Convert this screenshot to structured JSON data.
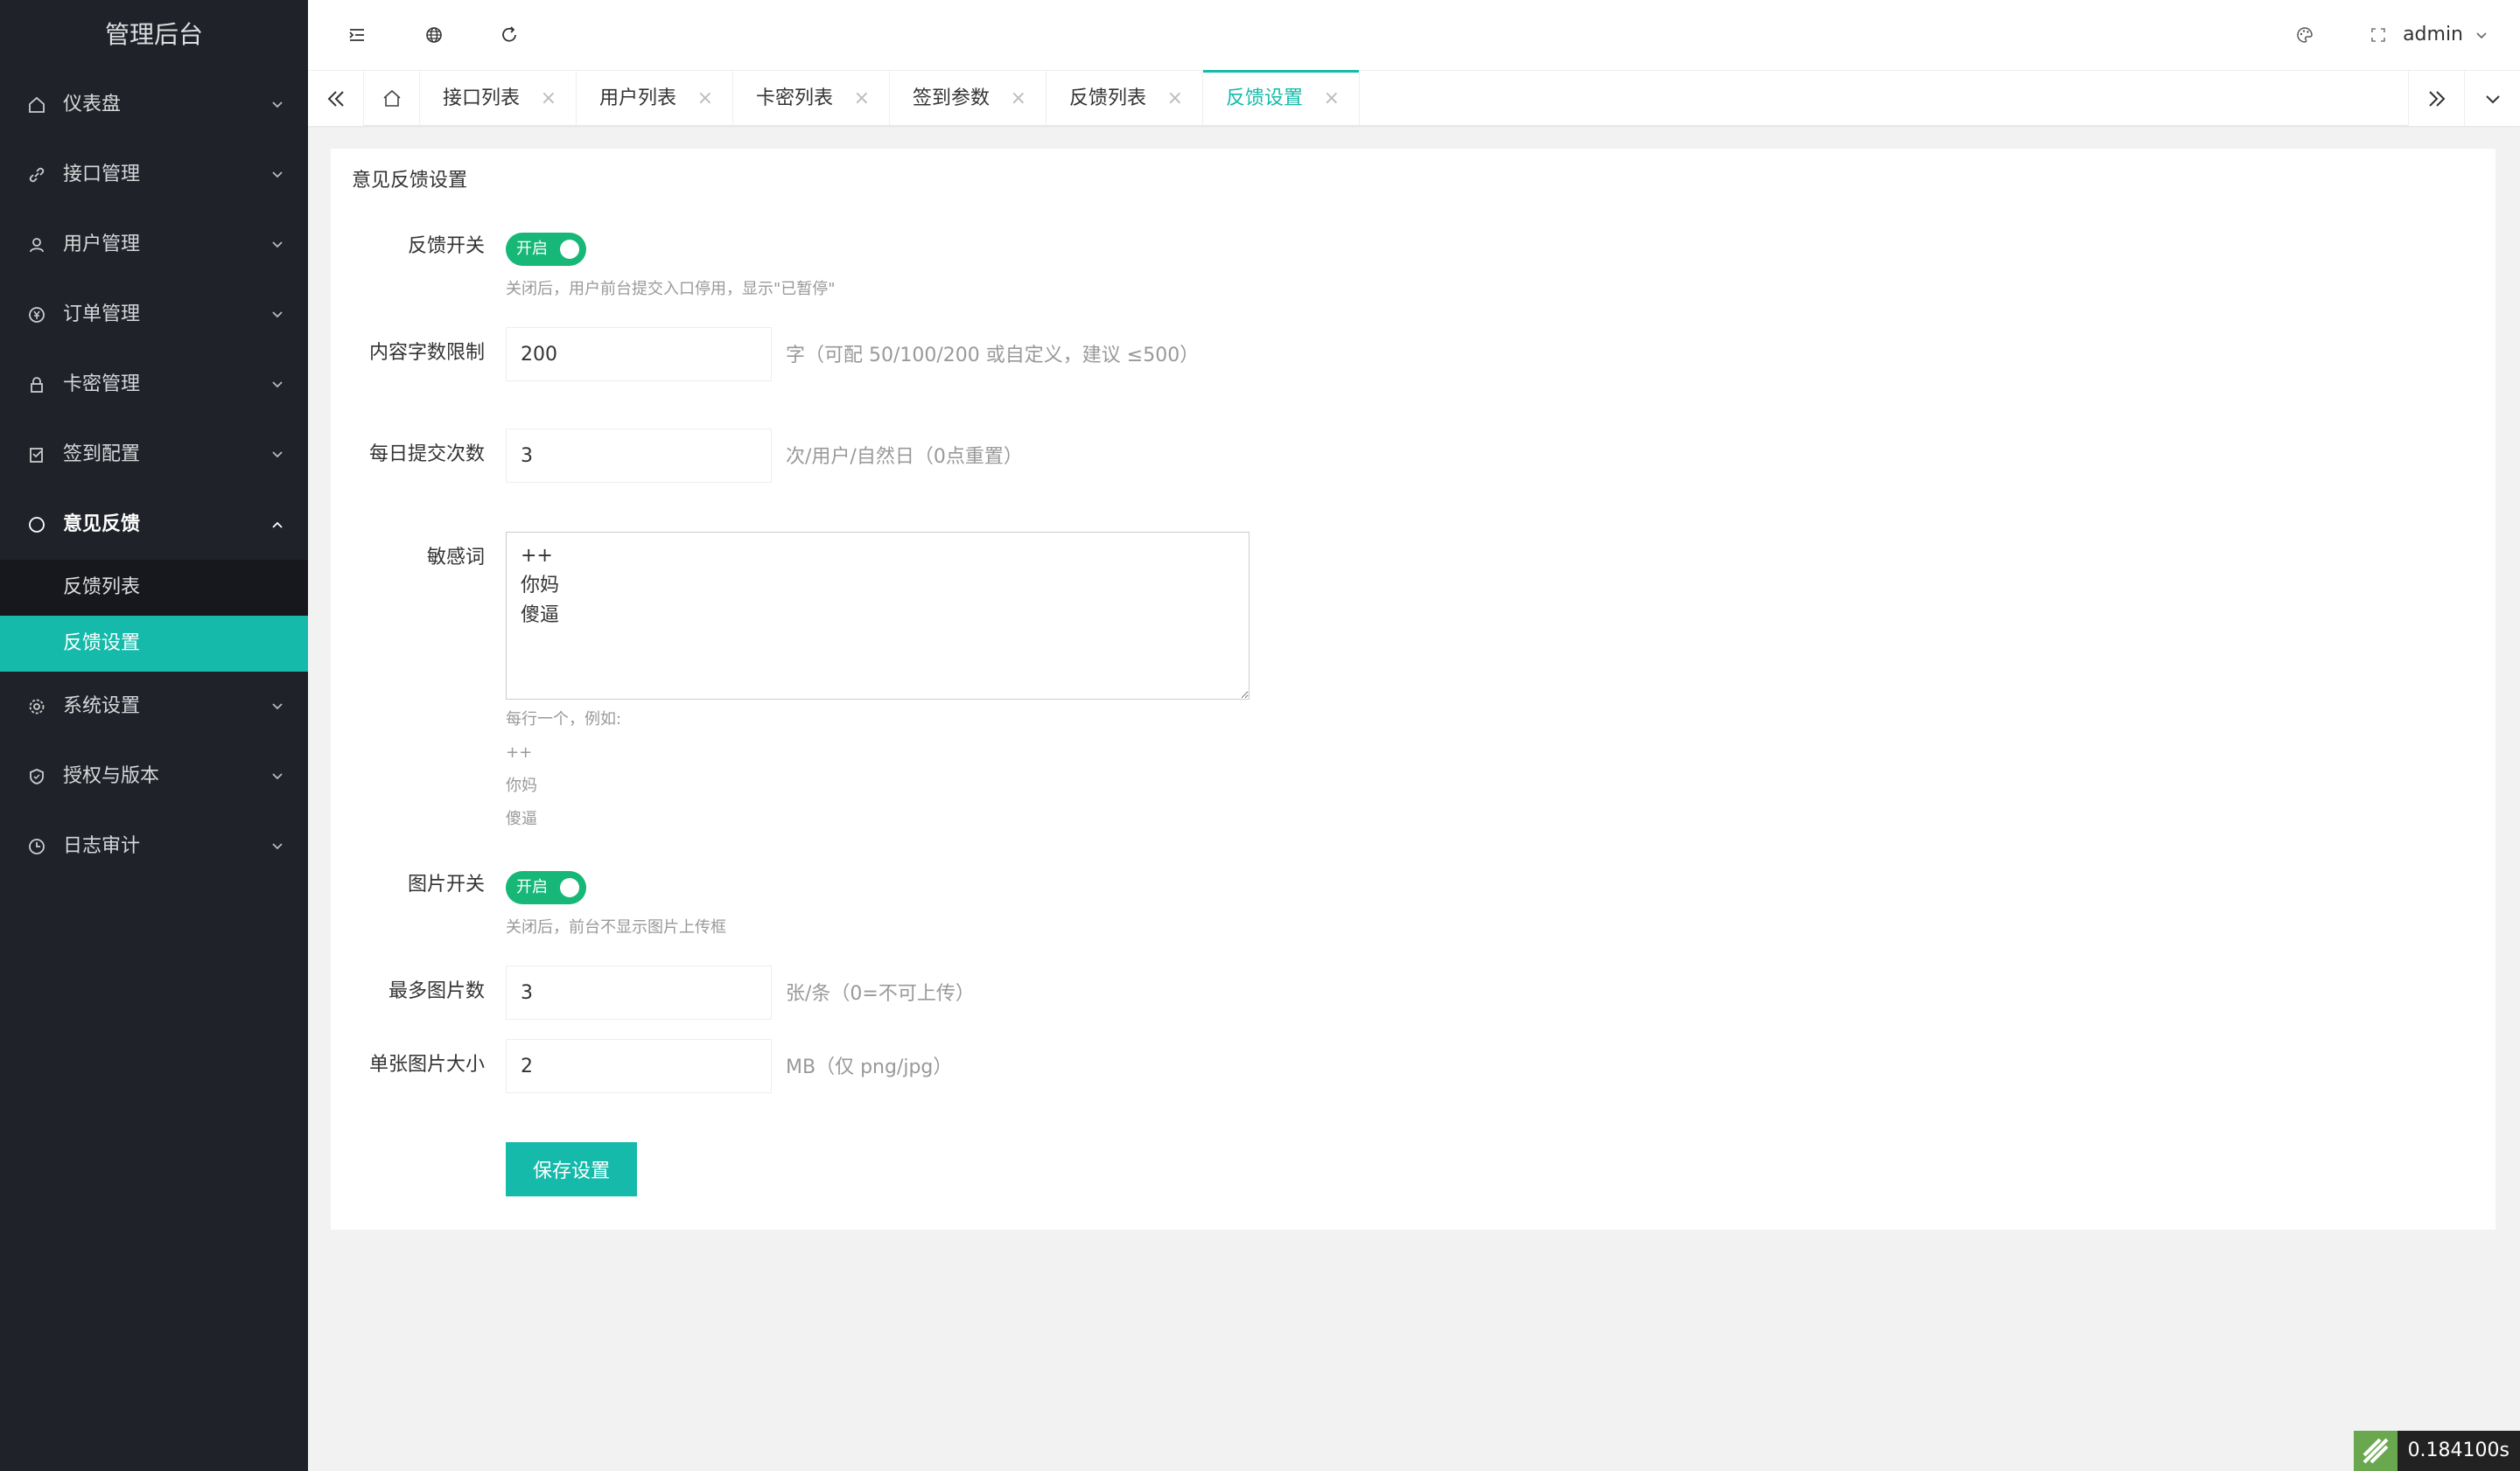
{
  "app": {
    "title": "管理后台"
  },
  "sidebar": {
    "items": [
      {
        "label": "仪表盘",
        "icon": "home-icon"
      },
      {
        "label": "接口管理",
        "icon": "link-icon"
      },
      {
        "label": "用户管理",
        "icon": "user-icon"
      },
      {
        "label": "订单管理",
        "icon": "yen-icon"
      },
      {
        "label": "卡密管理",
        "icon": "lock-icon"
      },
      {
        "label": "签到配置",
        "icon": "checkin-icon"
      },
      {
        "label": "意见反馈",
        "icon": "feedback-icon"
      },
      {
        "label": "系统设置",
        "icon": "gear-icon"
      },
      {
        "label": "授权与版本",
        "icon": "shield-icon"
      },
      {
        "label": "日志审计",
        "icon": "clock-icon"
      }
    ],
    "feedback_sub": [
      {
        "label": "反馈列表"
      },
      {
        "label": "反馈设置"
      }
    ]
  },
  "header": {
    "user": "admin"
  },
  "tabs": [
    {
      "label": "接口列表",
      "close": "×"
    },
    {
      "label": "用户列表",
      "close": "×"
    },
    {
      "label": "卡密列表",
      "close": "×"
    },
    {
      "label": "签到参数",
      "close": "×"
    },
    {
      "label": "反馈列表",
      "close": "×"
    },
    {
      "label": "反馈设置",
      "close": "×"
    }
  ],
  "form": {
    "title": "意见反馈设置",
    "feedback_switch": {
      "label": "反馈开关",
      "state": "开启",
      "help": "关闭后，用户前台提交入口停用，显示\"已暂停\""
    },
    "max_chars": {
      "label": "内容字数限制",
      "value": "200",
      "suffix": "字（可配 50/100/200 或自定义，建议 ≤500）"
    },
    "daily_limit": {
      "label": "每日提交次数",
      "value": "3",
      "suffix": "次/用户/自然日（0点重置）"
    },
    "sensitive": {
      "label": "敏感词",
      "value": "++\n你妈\n傻逼",
      "help_title": "每行一个，例如:",
      "help_lines": [
        "++",
        "你妈",
        "傻逼"
      ]
    },
    "image_switch": {
      "label": "图片开关",
      "state": "开启",
      "help": "关闭后，前台不显示图片上传框"
    },
    "max_images": {
      "label": "最多图片数",
      "value": "3",
      "suffix": "张/条（0=不可上传）"
    },
    "image_size": {
      "label": "单张图片大小",
      "value": "2",
      "suffix": "MB（仅 png/jpg）"
    },
    "save_label": "保存设置"
  },
  "timer": {
    "value": "0.184100s"
  },
  "colors": {
    "accent": "#16baaa",
    "sidebar_bg": "#20222a",
    "toggle_on": "#16b777"
  }
}
